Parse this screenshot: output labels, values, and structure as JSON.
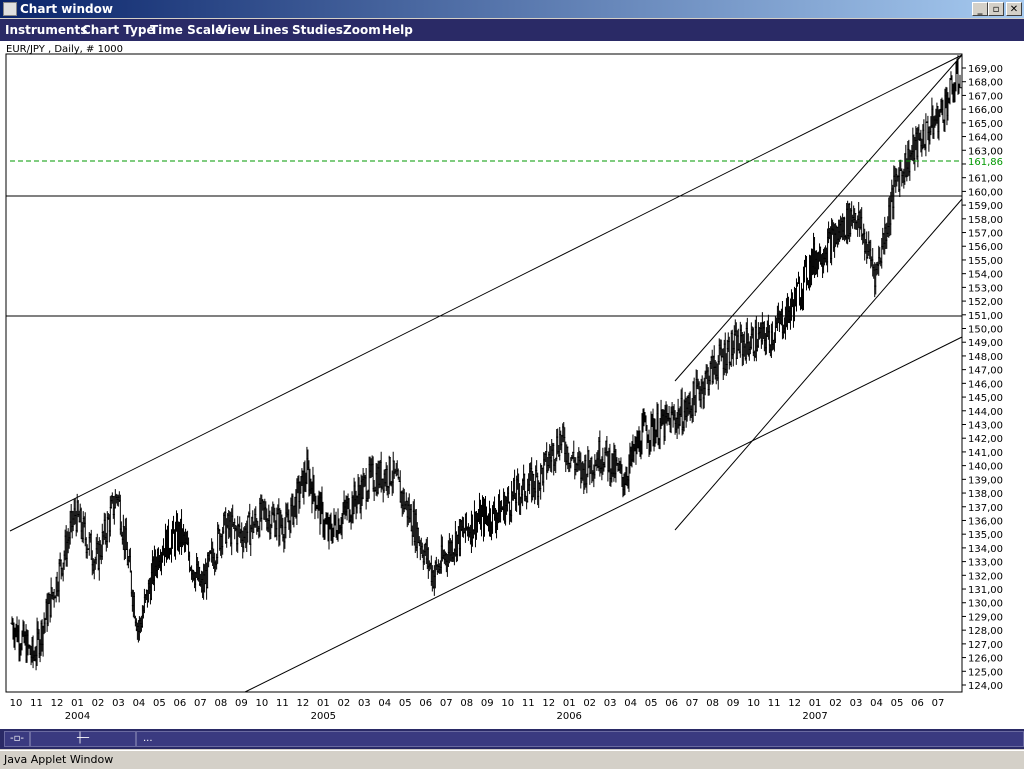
{
  "window": {
    "title": "Chart window"
  },
  "menu": [
    "Instruments",
    "Chart Type",
    "Time Scale",
    "View",
    "Lines",
    "Studies",
    "Zoom",
    "Help"
  ],
  "chart": {
    "header": "EUR/JPY , Daily, # 1000",
    "current_price_label": "161,86",
    "price_color": "#009900",
    "price_ticks": [
      "169,00",
      "168,00",
      "167,00",
      "166,00",
      "165,00",
      "164,00",
      "163,00",
      "162,00",
      "161,00",
      "160,00",
      "159,00",
      "158,00",
      "157,00",
      "156,00",
      "155,00",
      "154,00",
      "153,00",
      "152,00",
      "151,00",
      "150,00",
      "149,00",
      "148,00",
      "147,00",
      "146,00",
      "145,00",
      "144,00",
      "143,00",
      "142,00",
      "141,00",
      "140,00",
      "139,00",
      "138,00",
      "137,00",
      "136,00",
      "135,00",
      "134,00",
      "133,00",
      "132,00",
      "131,00",
      "130,00",
      "129,00",
      "128,00",
      "127,00",
      "126,00",
      "125,00",
      "124,00"
    ],
    "month_ticks": [
      "10",
      "11",
      "12",
      "01",
      "02",
      "03",
      "04",
      "05",
      "06",
      "07",
      "08",
      "09",
      "10",
      "11",
      "12",
      "01",
      "02",
      "03",
      "04",
      "05",
      "06",
      "07",
      "08",
      "09",
      "10",
      "11",
      "12",
      "01",
      "02",
      "03",
      "04",
      "05",
      "06",
      "07",
      "08",
      "09",
      "10",
      "11",
      "12",
      "01",
      "02",
      "03",
      "04",
      "05",
      "06",
      "07"
    ],
    "year_labels": [
      "2004",
      "2005",
      "2006",
      "2007"
    ]
  },
  "chart_data": {
    "type": "candlestick",
    "title": "EUR/JPY , Daily, # 1000",
    "ylim": [
      124,
      170
    ],
    "x_range": [
      "2003-10",
      "2007-07"
    ],
    "current_price": 161.86,
    "horizontal_levels": [
      159.4,
      150.7
    ],
    "monthly_path": [
      {
        "m": "2003-10",
        "v": 128.5
      },
      {
        "m": "2003-11",
        "v": 126.0
      },
      {
        "m": "2003-12",
        "v": 131.0
      },
      {
        "m": "2004-01",
        "v": 136.5
      },
      {
        "m": "2004-02",
        "v": 133.0
      },
      {
        "m": "2004-03",
        "v": 138.0
      },
      {
        "m": "2004-04",
        "v": 128.0
      },
      {
        "m": "2004-05",
        "v": 134.0
      },
      {
        "m": "2004-06",
        "v": 135.0
      },
      {
        "m": "2004-07",
        "v": 131.0
      },
      {
        "m": "2004-08",
        "v": 135.5
      },
      {
        "m": "2004-09",
        "v": 135.0
      },
      {
        "m": "2004-10",
        "v": 136.5
      },
      {
        "m": "2004-11",
        "v": 135.5
      },
      {
        "m": "2004-12",
        "v": 139.5
      },
      {
        "m": "2005-01",
        "v": 135.0
      },
      {
        "m": "2005-02",
        "v": 137.0
      },
      {
        "m": "2005-03",
        "v": 139.0
      },
      {
        "m": "2005-04",
        "v": 139.5
      },
      {
        "m": "2005-05",
        "v": 136.0
      },
      {
        "m": "2005-06",
        "v": 132.0
      },
      {
        "m": "2005-07",
        "v": 134.5
      },
      {
        "m": "2005-08",
        "v": 136.0
      },
      {
        "m": "2005-09",
        "v": 136.5
      },
      {
        "m": "2005-10",
        "v": 138.0
      },
      {
        "m": "2005-11",
        "v": 139.0
      },
      {
        "m": "2005-12",
        "v": 142.0
      },
      {
        "m": "2006-01",
        "v": 139.5
      },
      {
        "m": "2006-02",
        "v": 141.0
      },
      {
        "m": "2006-03",
        "v": 139.0
      },
      {
        "m": "2006-04",
        "v": 142.5
      },
      {
        "m": "2006-05",
        "v": 143.0
      },
      {
        "m": "2006-06",
        "v": 144.0
      },
      {
        "m": "2006-07",
        "v": 146.5
      },
      {
        "m": "2006-08",
        "v": 148.5
      },
      {
        "m": "2006-09",
        "v": 149.0
      },
      {
        "m": "2006-10",
        "v": 149.5
      },
      {
        "m": "2006-11",
        "v": 151.5
      },
      {
        "m": "2006-12",
        "v": 155.0
      },
      {
        "m": "2007-01",
        "v": 156.5
      },
      {
        "m": "2007-02",
        "v": 158.5
      },
      {
        "m": "2007-03",
        "v": 154.0
      },
      {
        "m": "2007-04",
        "v": 161.0
      },
      {
        "m": "2007-05",
        "v": 163.5
      },
      {
        "m": "2007-06",
        "v": 165.5
      },
      {
        "m": "2007-07",
        "v": 168.5
      }
    ]
  }
}
